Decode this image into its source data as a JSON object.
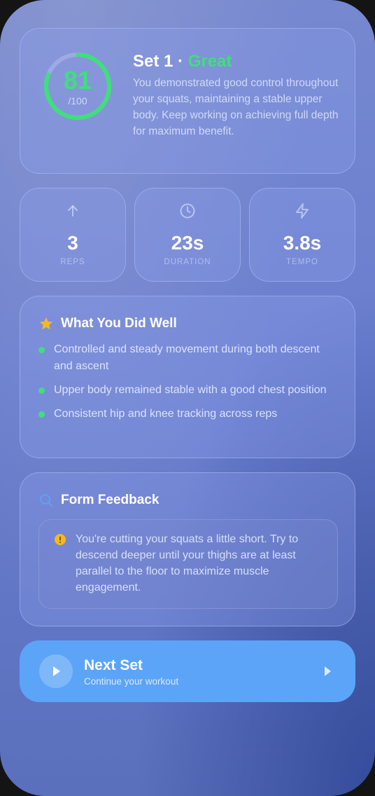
{
  "score": {
    "value": "81",
    "max": "/100",
    "fraction": 0.81,
    "color": "#3ee07a"
  },
  "set": {
    "title": "Set 1 ·",
    "rating": "Great",
    "description": "You demonstrated good control throughout your squats, maintaining a stable upper body. Keep working on achieving full depth for maximum benefit."
  },
  "stats": [
    {
      "icon": "arrow-up-icon",
      "value": "3",
      "label": "REPS"
    },
    {
      "icon": "clock-icon",
      "value": "23s",
      "label": "DURATION"
    },
    {
      "icon": "lightning-icon",
      "value": "3.8s",
      "label": "TEMPO"
    }
  ],
  "did_well": {
    "icon": "star-icon",
    "title": "What You Did Well",
    "items": [
      "Controlled and steady movement during both descent and ascent",
      "Upper body remained stable with a good chest position",
      "Consistent hip and knee tracking across reps"
    ]
  },
  "feedback": {
    "icon": "search-icon",
    "title": "Form Feedback",
    "warning_icon": "warning-icon",
    "text": "You're cutting your squats a little short. Try to descend deeper until your thighs are at least parallel to the floor to maximize muscle engagement."
  },
  "next": {
    "title": "Next Set",
    "subtitle": "Continue your workout",
    "icon": "play-icon",
    "chevron_icon": "chevron-right-icon"
  },
  "colors": {
    "accent_green": "#3ee07a",
    "button_blue": "#5ca4f8",
    "star_yellow": "#f5b820",
    "warning_yellow": "#f5b820"
  }
}
